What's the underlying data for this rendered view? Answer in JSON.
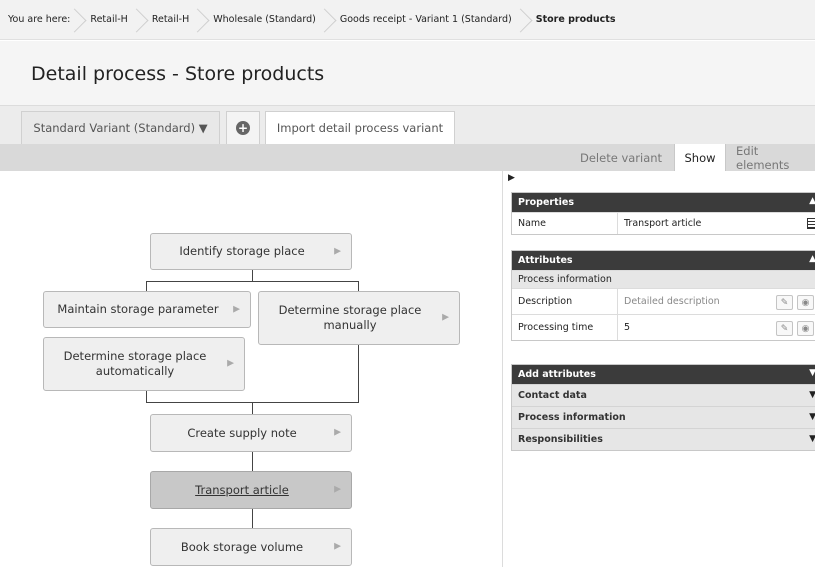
{
  "breadcrumb": {
    "label": "You are here:",
    "items": [
      "Retail-H",
      "Retail-H",
      "Wholesale (Standard)",
      "Goods receipt - Variant 1 (Standard)",
      "Store products"
    ]
  },
  "page": {
    "title": "Detail process - Store products"
  },
  "tabs": {
    "variant": "Standard Variant (Standard) ▼",
    "import": "Import detail process variant"
  },
  "actions": {
    "delete": "Delete variant",
    "show": "Show",
    "edit": "Edit elements"
  },
  "diagram": {
    "nodes": [
      "Identify storage place",
      "Maintain storage parameter",
      "Determine storage place manually",
      "Determine storage place automatically",
      "Create supply note",
      "Transport article",
      "Book storage volume"
    ]
  },
  "panel": {
    "properties": {
      "title": "Properties",
      "name_label": "Name",
      "name_value": "Transport article"
    },
    "attributes": {
      "title": "Attributes",
      "section": "Process information",
      "rows": [
        {
          "label": "Description",
          "value": "Detailed description"
        },
        {
          "label": "Processing time",
          "value": "5"
        }
      ]
    },
    "add_attributes": {
      "title": "Add attributes",
      "items": [
        "Contact data",
        "Process information",
        "Responsibilities"
      ]
    }
  },
  "colors": {
    "header_dark": "#3b3b3b",
    "active_node": "#c8c8c8"
  }
}
